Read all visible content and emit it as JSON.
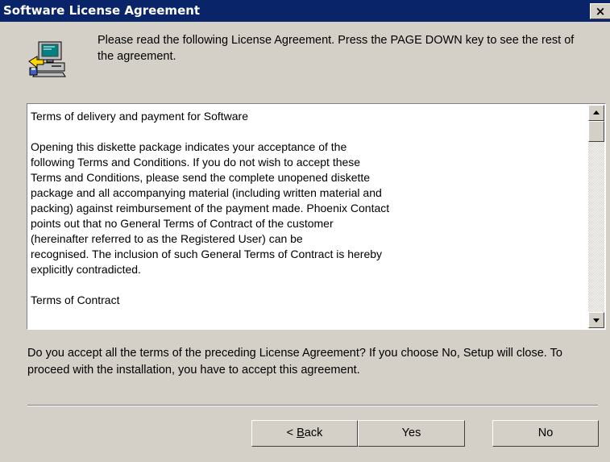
{
  "window": {
    "title": "Software License Agreement",
    "close_label": "×"
  },
  "header": {
    "icon": "setup-computer-icon",
    "text": "Please read the following License Agreement. Press the PAGE DOWN key to see the rest of the agreement."
  },
  "license": {
    "paragraphs": [
      "Terms of delivery and payment for Software",
      "Opening this diskette package indicates your acceptance of the",
      "following Terms and Conditions. If you do not wish to accept these",
      "Terms and Conditions, please send the complete unopened diskette",
      "package and all accompanying material (including written material and",
      "packing) against reimbursement of the payment made. Phoenix Contact",
      "points out that no General Terms of Contract of the customer",
      "(hereinafter referred to as the Registered User) can be",
      "recognised. The inclusion of such General Terms of Contract is hereby",
      "explicitly contradicted.",
      "Terms of Contract"
    ],
    "scroll_position": 0.0
  },
  "question": "Do you accept all the terms of the preceding License Agreement? If you choose No, Setup will close. To proceed with the installation, you have to accept this agreement.",
  "buttons": {
    "back_prefix": "< ",
    "back_mnemonic": "B",
    "back_rest": "ack",
    "yes": "Yes",
    "no": "No"
  },
  "colors": {
    "titlebar": "#0a246a",
    "dialog_face": "#d4d0c8"
  }
}
